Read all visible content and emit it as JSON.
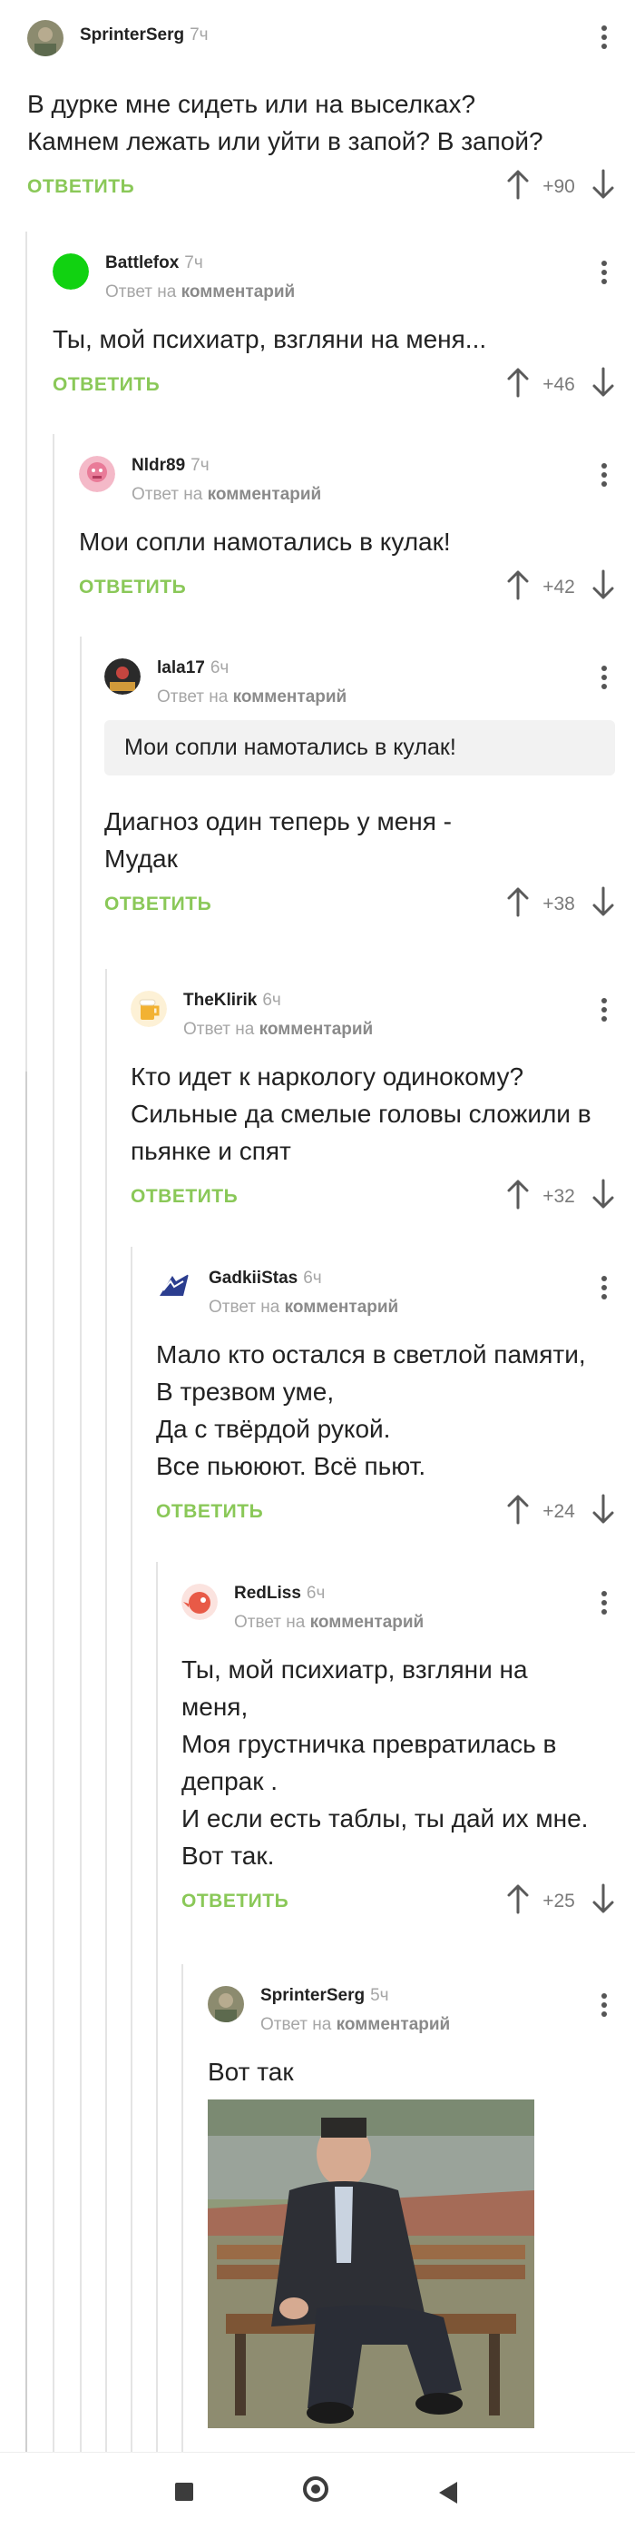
{
  "labels": {
    "reply": "ОТВЕТИТЬ",
    "reply_to_prefix": "Ответ на",
    "reply_to_link": "комментарий"
  },
  "comments": [
    {
      "user": "SprinterSerg",
      "time": "7ч",
      "text": [
        "В дурке мне сидеть или на выселках?",
        "Камнем лежать или уйти в запой? В запой?"
      ],
      "score": "+90",
      "avatar": "photo-avatar-icon"
    },
    {
      "user": "Battlefox",
      "time": "7ч",
      "text": [
        "Ты, мой психиатр, взгляни на меня..."
      ],
      "score": "+46",
      "avatar": "green-circle-avatar-icon"
    },
    {
      "user": "Nldr89",
      "time": "7ч",
      "text": [
        "Мои сопли намотались в кулак!"
      ],
      "score": "+42",
      "avatar": "pink-face-avatar-icon"
    },
    {
      "user": "lala17",
      "time": "6ч",
      "quote": "Мои сопли намотались в кулак!",
      "text": [
        "Диагноз один теперь у меня -",
        "Мудак"
      ],
      "score": "+38",
      "avatar": "dark-avatar-icon"
    },
    {
      "user": "TheKlirik",
      "time": "6ч",
      "text": [
        "Кто идет к наркологу одинокому?",
        "Сильные да смелые головы сложили в",
        "пьянке и спят"
      ],
      "score": "+32",
      "avatar": "beer-mug-avatar-icon"
    },
    {
      "user": "GadkiiStas",
      "time": "6ч",
      "text": [
        "Мало кто остался в светлой памяти,",
        "В трезвом уме,",
        "Да с твёрдой рукой.",
        "Все пьююют. Всё пьют."
      ],
      "score": "+24",
      "avatar": "flag-avatar-icon"
    },
    {
      "user": "RedLiss",
      "time": "6ч",
      "text": [
        "Ты, мой психиатр, взгляни на",
        "меня,",
        "Моя грустничка превратилась в",
        "депрак .",
        "И если есть таблы, ты дай их мне.",
        "Вот так."
      ],
      "score": "+25",
      "avatar": "red-bird-avatar-icon"
    },
    {
      "user": "SprinterSerg",
      "time": "5ч",
      "text": [
        "Вот так"
      ],
      "avatar": "photo-avatar-icon",
      "image": "man-on-bench-gif"
    }
  ],
  "navbar": {
    "recent_apps": "square-icon",
    "home": "circle-home-icon",
    "back": "triangle-back-icon"
  },
  "colors": {
    "reply_green": "#8ac858",
    "thread_line": "#e4e4e4",
    "muted_text": "#a6a6a6"
  }
}
